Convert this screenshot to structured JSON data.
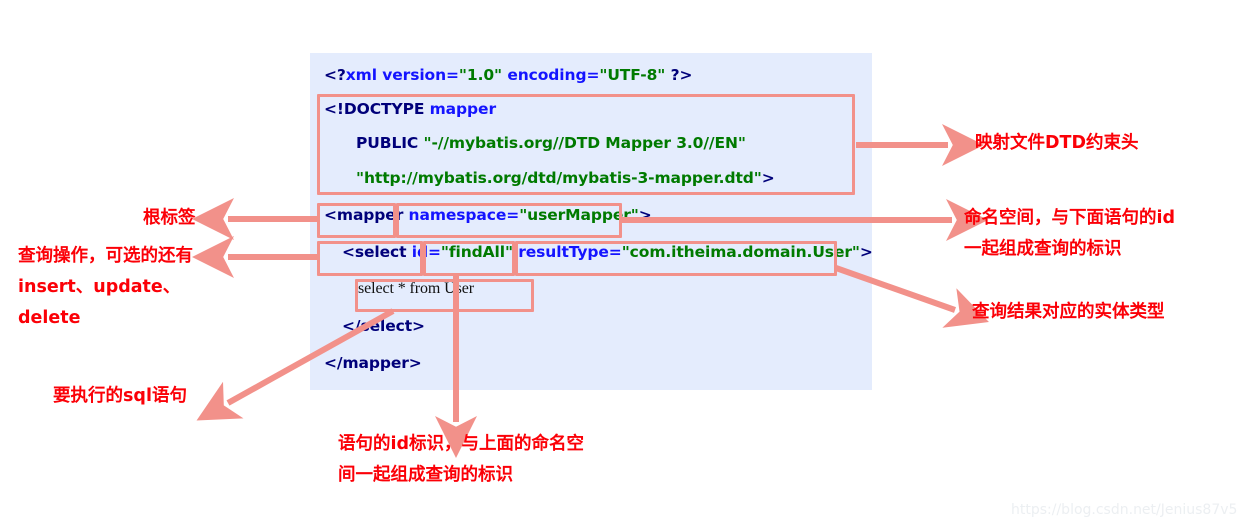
{
  "code": {
    "background_color": "#e4ecfd",
    "lines": {
      "xml_decl": {
        "punct_open": "<?",
        "tag": "xml",
        "space1": " ",
        "attr1": "version=",
        "str1": "\"1.0\"",
        "space2": " ",
        "attr2": "encoding=",
        "str2": "\"UTF-8\"",
        "punct_close": " ?>"
      },
      "doctype": {
        "keyword": "<!DOCTYPE",
        "space": " ",
        "name": "mapper"
      },
      "public": {
        "keyword": "PUBLIC",
        "space": " ",
        "value": "\"-//mybatis.org//DTD Mapper 3.0//EN\""
      },
      "dtd_url": {
        "value": "\"http://mybatis.org/dtd/mybatis-3-mapper.dtd\"",
        "close": ">"
      },
      "mapper_open": {
        "open": "<mapper",
        "space": " ",
        "attr": "namespace=",
        "str": "\"userMapper\"",
        "close": ">"
      },
      "select_open": {
        "open": "<select",
        "space1": " ",
        "attr1": "id=",
        "str1": "\"findAll\"",
        "space2": " ",
        "attr2": "resultType=",
        "str2": "\"com.itheima.domain.User\"",
        "close": ">"
      },
      "sql": "select * from User",
      "select_close": "</select>",
      "mapper_close": "</mapper>"
    }
  },
  "highlights": {
    "color": "#f2918a",
    "boxes": [
      {
        "name": "doctype-block"
      },
      {
        "name": "mapper-tag"
      },
      {
        "name": "namespace-attribute"
      },
      {
        "name": "select-tag"
      },
      {
        "name": "id-attribute"
      },
      {
        "name": "resulttype-attribute"
      },
      {
        "name": "sql-statement"
      }
    ]
  },
  "annotations": {
    "dtd_header": "映射文件DTD约束头",
    "namespace_line1": "命名空间，与下面语句的id",
    "namespace_line2": "一起组成查询的标识",
    "root_tag": "根标签",
    "query_line1": "查询操作，可选的还有",
    "query_line2": "insert、update、",
    "query_line3": "delete",
    "result_type": "查询结果对应的实体类型",
    "sql_statement": "要执行的sql语句",
    "id_line1": "语句的id标识，与上面的命名空",
    "id_line2": "间一起组成查询的标识",
    "text_color": "#fb0007"
  },
  "watermark": {
    "text": "https://blog.csdn.net/Jenius87v5"
  }
}
